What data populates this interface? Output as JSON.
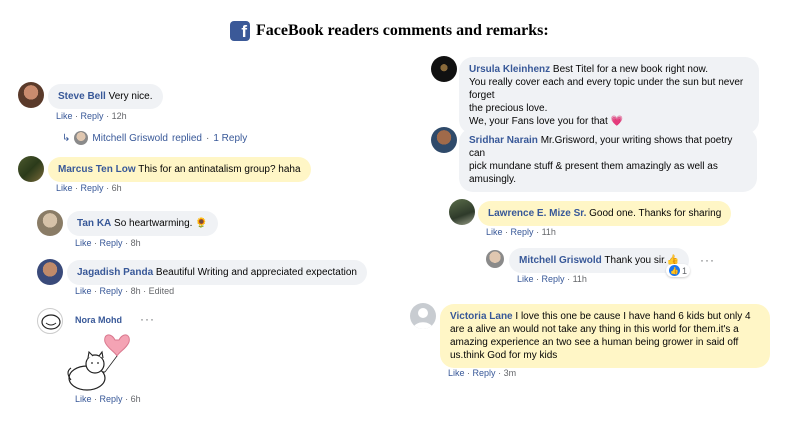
{
  "header": {
    "title": "FaceBook readers comments and remarks:",
    "brand_color": "#3b5998",
    "icon": "facebook-icon"
  },
  "labels": {
    "like": "Like",
    "reply": "Reply",
    "sep": "·"
  },
  "comments": {
    "steve": {
      "name": "Steve Bell",
      "text": "Very nice.",
      "time": "12h"
    },
    "steve_replies": {
      "name": "Mitchell Griswold",
      "text": "replied",
      "sep": "·",
      "count": "1 Reply"
    },
    "marcus": {
      "name": "Marcus Ten Low",
      "text": "This for an antinatalism group? haha",
      "time": "6h"
    },
    "tan": {
      "name": "Tan KA",
      "text": "So heartwarming.",
      "emoji": "🌻",
      "time": "8h"
    },
    "jagadish": {
      "name": "Jagadish Panda",
      "text": "Beautiful Writing and appreciated expectation",
      "time": "8h",
      "edited": "Edited"
    },
    "nora": {
      "name": "Nora Mohd",
      "time": "6h",
      "sticker": "cat-with-heart-balloon-sticker"
    },
    "ursula": {
      "name": "Ursula Kleinhenz",
      "text1": "Best Titel for a new book right now.",
      "text2": "You really cover each and every topic under the sun but never forget",
      "text3": "the precious love.",
      "text4": "We, your Fans love you for that",
      "emoji": "💗"
    },
    "sridhar": {
      "name": "Sridhar Narain",
      "text1": "Mr.Grisword, your writing shows that poetry can",
      "text2": "pick mundane stuff & present them amazingly as well as",
      "text3": "amusingly."
    },
    "lawrence": {
      "name": "Lawrence E. Mize Sr.",
      "text": "Good one. Thanks for sharing",
      "time": "11h"
    },
    "mitchell": {
      "name": "Mitchell Griswold",
      "text": "Thank you sir.",
      "emoji": "👍",
      "time": "11h",
      "reactions": "1"
    },
    "victoria": {
      "name": "Victoria Lane",
      "text1": "I love this one be cause I have hand 6 kids but only 4",
      "text2": "are a alive an would not take any thing in this world for them.it's a",
      "text3": "amazing experience an two see a human being grower in said off",
      "text4": "us.think God for my kids",
      "time": "3m"
    }
  }
}
